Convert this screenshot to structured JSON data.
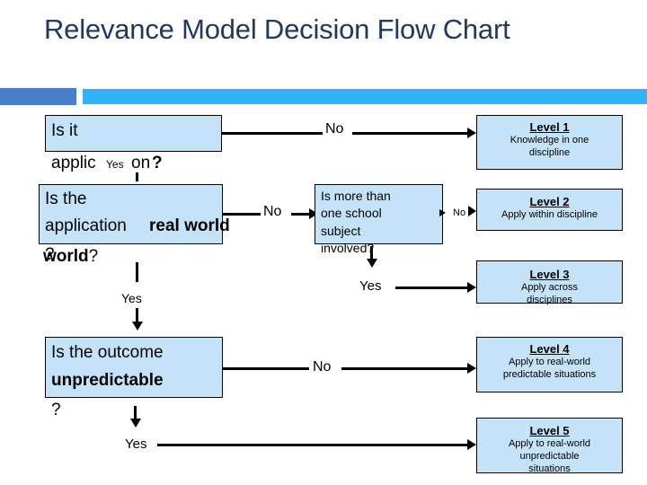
{
  "slide": {
    "title": "Relevance Model Decision Flow Chart",
    "accent_color": "#33b1fb",
    "accent_square_color": "#4a7ecb",
    "title_color": "#1f3864",
    "box_fill_color": "#c5e3f8",
    "box_border_color": "#000000"
  },
  "decisions": [
    {
      "id": "is-it-application",
      "text_plain": "Is it application?",
      "text_lead": "Is it",
      "text_rest": "applic",
      "text_tail": "on",
      "text_mark": "?"
    },
    {
      "id": "is-real-world",
      "text_lead": "Is the",
      "text_rest": "application ",
      "text_bold": "real world",
      "text_mark": "?"
    },
    {
      "id": "more-than-one-subject",
      "line1": "Is more than",
      "line2": "one school",
      "line3": "subject",
      "line4": "involved?"
    },
    {
      "id": "outcome-unpredictable",
      "text_lead": "Is the outcome",
      "text_bold": "unpredictable",
      "text_mark": "?"
    }
  ],
  "levels": [
    {
      "id": "level-1",
      "title": "Level 1",
      "description": "Knowledge in one discipline",
      "desc_line1": "Knowledge in one",
      "desc_line2": "discipline",
      "overflow_line": ""
    },
    {
      "id": "level-2",
      "title": "Level 2",
      "description": "Apply within discipline",
      "desc_line1": "Apply within discipline",
      "desc_line2": "",
      "overflow_line": ""
    },
    {
      "id": "level-3",
      "title": "Level 3",
      "description": "Apply across disciplines",
      "desc_line1": "Apply across",
      "desc_line2": "",
      "overflow_line": "disciplines"
    },
    {
      "id": "level-4",
      "title": "Level 4",
      "description": "Apply to real-world predictable situations",
      "desc_line1": "Apply to real-world",
      "desc_line2": "predictable situations",
      "overflow_line": ""
    },
    {
      "id": "level-5",
      "title": "Level 5",
      "description": "Apply to real-world unpredictable situations",
      "desc_line1": "Apply to real-world",
      "desc_line2": "unpredictable",
      "overflow_line": "situations"
    }
  ],
  "edge_labels": {
    "application_no": "No",
    "application_yes": "Yes",
    "realworld_no": "No",
    "realworld_yes": "Yes",
    "subject_no": "No",
    "subject_yes": "Yes",
    "unpredictable_no": "No",
    "unpredictable_yes": "Yes"
  }
}
